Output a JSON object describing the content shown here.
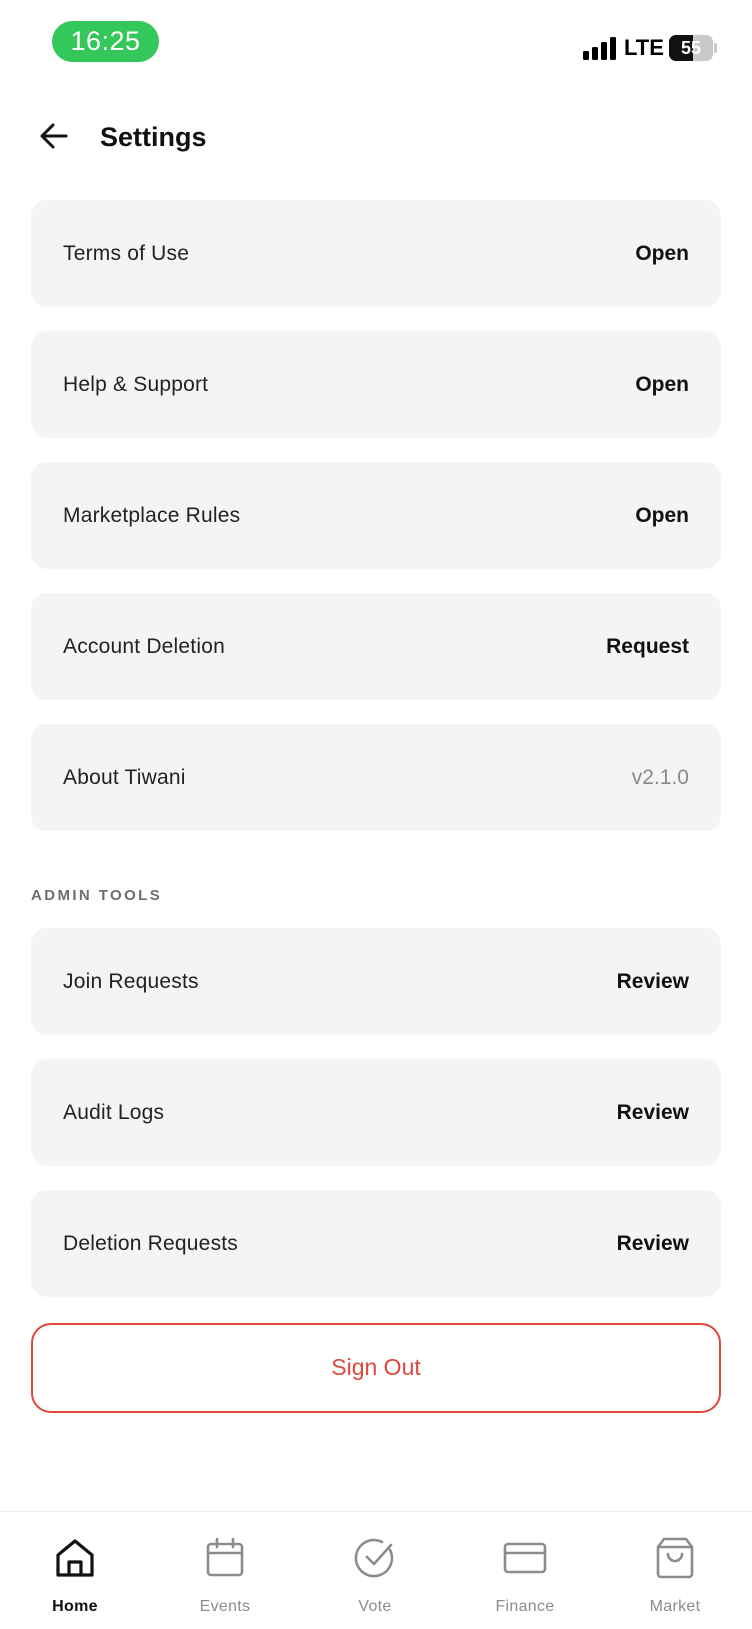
{
  "status_bar": {
    "time": "16:25",
    "network": "LTE",
    "battery_level": "55",
    "battery_fraction": 0.55,
    "icons": [
      "signal-bars-icon",
      "battery-icon"
    ]
  },
  "header": {
    "back_icon": "arrow-left-icon",
    "title": "Settings"
  },
  "settings": [
    {
      "label": "Terms of Use",
      "action": "Open"
    },
    {
      "label": "Help & Support",
      "action": "Open"
    },
    {
      "label": "Marketplace Rules",
      "action": "Open"
    },
    {
      "label": "Account Deletion",
      "action": "Request"
    },
    {
      "label": "About Tiwani",
      "value": "v2.1.0"
    }
  ],
  "admin_tools": {
    "section_label": "ADMIN TOOLS",
    "items": [
      {
        "label": "Join Requests",
        "action": "Review"
      },
      {
        "label": "Audit Logs",
        "action": "Review"
      },
      {
        "label": "Deletion Requests",
        "action": "Review"
      }
    ]
  },
  "sign_out_label": "Sign Out",
  "bottom_nav": {
    "items": [
      {
        "label": "Home",
        "icon": "home-icon",
        "active": true
      },
      {
        "label": "Events",
        "icon": "calendar-icon",
        "active": false
      },
      {
        "label": "Vote",
        "icon": "check-circle-icon",
        "active": false
      },
      {
        "label": "Finance",
        "icon": "credit-card-icon",
        "active": false
      },
      {
        "label": "Market",
        "icon": "shopping-bag-icon",
        "active": false
      }
    ]
  },
  "colors": {
    "time_pill": "#34c759",
    "danger": "#e0463d",
    "row_background": "#f4f4f4",
    "active_nav": "#111111",
    "inactive_nav": "#8c8c8c"
  }
}
